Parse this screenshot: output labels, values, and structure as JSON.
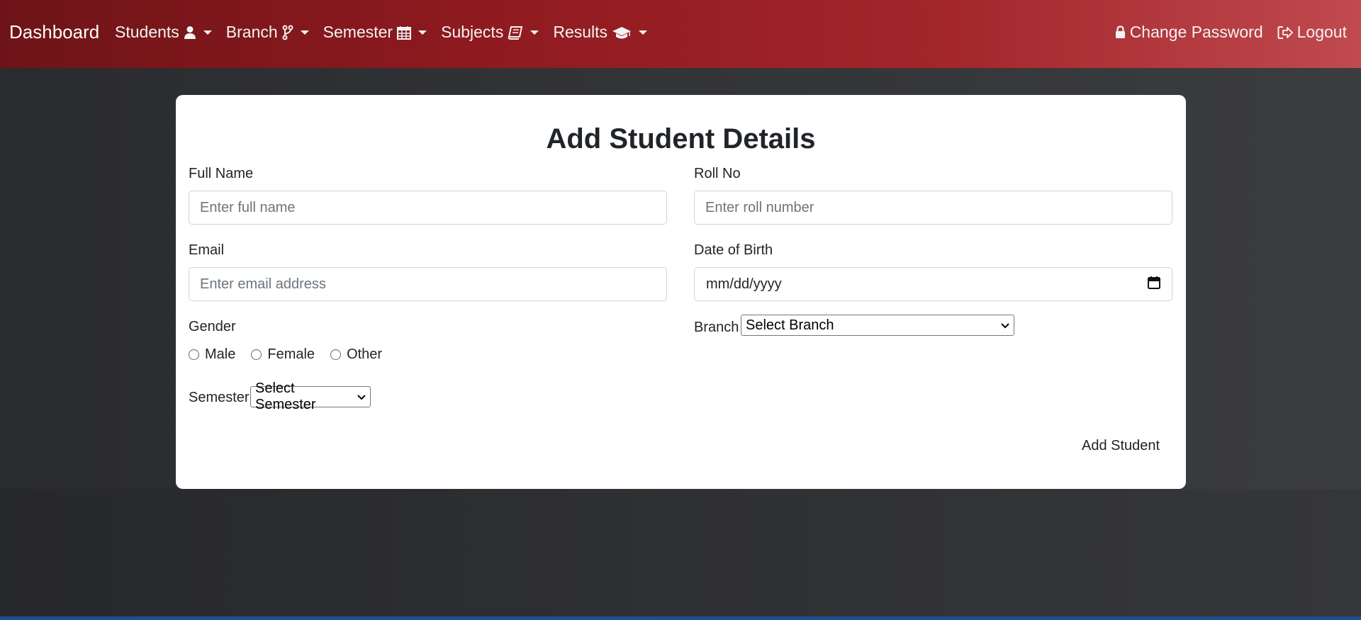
{
  "nav": {
    "brand": "Dashboard",
    "items": [
      {
        "label": "Students",
        "icon": "user-icon"
      },
      {
        "label": "Branch",
        "icon": "code-branch-icon"
      },
      {
        "label": "Semester",
        "icon": "calendar-icon"
      },
      {
        "label": "Subjects",
        "icon": "book-icon"
      },
      {
        "label": "Results",
        "icon": "graduation-cap-icon"
      }
    ],
    "change_password": "Change Password",
    "logout": "Logout"
  },
  "form": {
    "title": "Add Student Details",
    "full_name": {
      "label": "Full Name",
      "placeholder": "Enter full name"
    },
    "roll_no": {
      "label": "Roll No",
      "placeholder": "Enter roll number"
    },
    "email": {
      "label": "Email",
      "placeholder": "Enter email address"
    },
    "dob": {
      "label": "Date of Birth",
      "placeholder": "mm/dd/yyyy"
    },
    "gender": {
      "label": "Gender",
      "options": [
        "Male",
        "Female",
        "Other"
      ]
    },
    "branch": {
      "label": "Branch",
      "selected": "Select Branch"
    },
    "semester": {
      "label": "Semester",
      "selected": "Select Semester"
    },
    "submit": "Add Student"
  },
  "colors": {
    "navbar_start": "#6e1418",
    "navbar_end": "#c04a4e",
    "page_bg": "#333437",
    "card_bg": "#ffffff"
  }
}
